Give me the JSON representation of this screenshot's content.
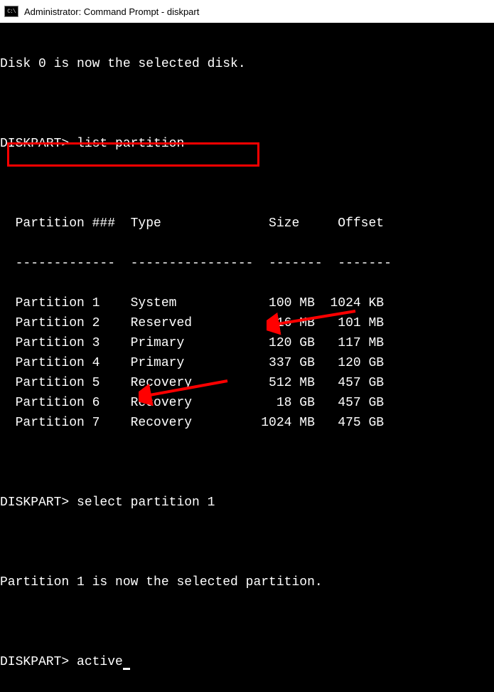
{
  "titlebar": {
    "icon_text": "C:\\",
    "title": "Administrator: Command Prompt - diskpart"
  },
  "lines": {
    "disk_selected": "Disk 0 is now the selected disk.",
    "prompt1": "DISKPART> ",
    "cmd1": "list partition",
    "header": "  Partition ###  Type              Size     Offset",
    "dashes": "  -------------  ----------------  -------  -------",
    "prompt2": "DISKPART> ",
    "cmd2": "select partition 1",
    "partition_selected": "Partition 1 is now the selected partition.",
    "prompt3": "DISKPART> ",
    "cmd3": "active"
  },
  "partitions": [
    {
      "num": "Partition 1",
      "type": "System",
      "size": "100 MB",
      "offset": "1024 KB"
    },
    {
      "num": "Partition 2",
      "type": "Reserved",
      "size": "16 MB",
      "offset": "101 MB"
    },
    {
      "num": "Partition 3",
      "type": "Primary",
      "size": "120 GB",
      "offset": "117 MB"
    },
    {
      "num": "Partition 4",
      "type": "Primary",
      "size": "337 GB",
      "offset": "120 GB"
    },
    {
      "num": "Partition 5",
      "type": "Recovery",
      "size": "512 MB",
      "offset": "457 GB"
    },
    {
      "num": "Partition 6",
      "type": "Recovery",
      "size": "18 GB",
      "offset": "457 GB"
    },
    {
      "num": "Partition 7",
      "type": "Recovery",
      "size": "1024 MB",
      "offset": "475 GB"
    }
  ]
}
